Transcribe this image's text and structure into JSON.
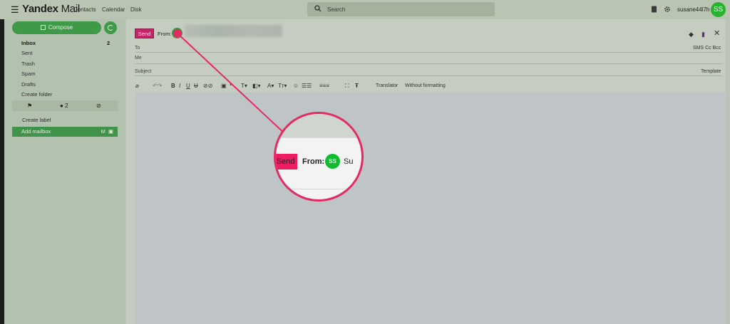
{
  "topbar": {
    "logo_brand": "Yandex",
    "logo_product": "Mail",
    "nav": [
      "Contacts",
      "Calendar",
      "Disk"
    ],
    "search_placeholder": "Search",
    "username": "susane44l7h",
    "avatar_initials": "SS"
  },
  "sidebar": {
    "compose_label": "Compose",
    "folders": [
      {
        "label": "Inbox",
        "count": "2"
      },
      {
        "label": "Sent"
      },
      {
        "label": "Trash"
      },
      {
        "label": "Spam"
      },
      {
        "label": "Drafts"
      },
      {
        "label": "Create folder"
      }
    ],
    "filter_unread_count": "2",
    "create_label": "Create label",
    "add_mailbox": "Add mailbox"
  },
  "compose_form": {
    "send_label": "Send",
    "from_label": "From:",
    "to_label": "To",
    "me_label": "Me",
    "subject_label": "Subject",
    "to_options": "SMS  Cc  Bcc",
    "template_label": "Template",
    "toolbar": {
      "translator": "Translator",
      "without_formatting": "Without formatting"
    }
  },
  "magnifier": {
    "send_label": "Send",
    "from_label": "From:",
    "avatar_initials": "SS",
    "cut_text": "Su"
  },
  "colors": {
    "accent_green": "#3e9a46",
    "send_pink": "#c5246a",
    "highlight": "#e32a63"
  }
}
